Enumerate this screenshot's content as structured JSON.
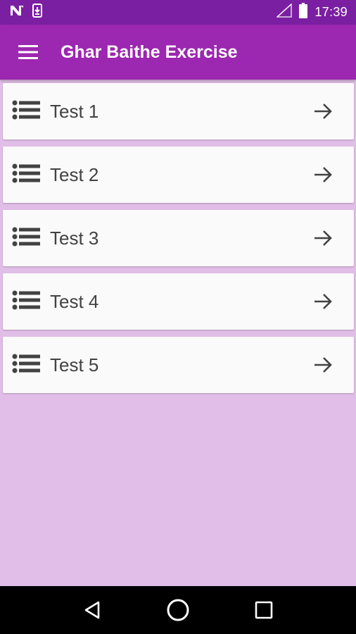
{
  "status_bar": {
    "time": "17:39",
    "icons": [
      "n-notification-icon",
      "download-notification-icon",
      "signal-icon",
      "battery-icon"
    ]
  },
  "app_bar": {
    "title": "Ghar Baithe Exercise",
    "menu_icon": "hamburger-menu-icon"
  },
  "list": {
    "items": [
      {
        "label": "Test 1"
      },
      {
        "label": "Test 2"
      },
      {
        "label": "Test 3"
      },
      {
        "label": "Test 4"
      },
      {
        "label": "Test 5"
      }
    ],
    "item_icon": "list-bullets-icon",
    "action_icon": "arrow-right-icon"
  },
  "nav_bar": {
    "buttons": [
      "back-icon",
      "home-icon",
      "recents-icon"
    ]
  },
  "colors": {
    "status_bar": "#7B1FA2",
    "app_bar": "#9C27B0",
    "background": "#E1BEE7",
    "card": "#FAFAFA",
    "text": "#424242"
  }
}
